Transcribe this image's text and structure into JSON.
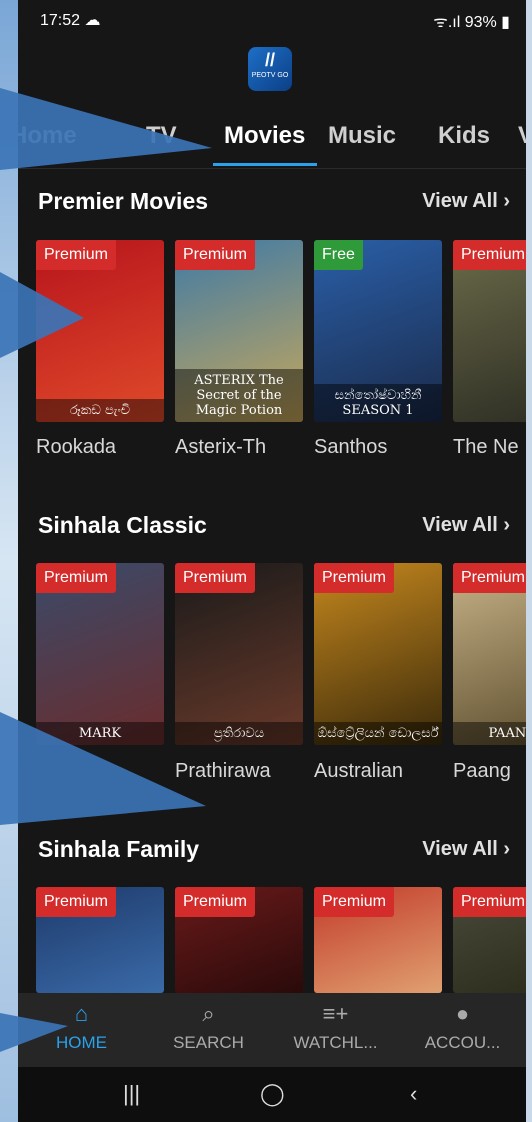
{
  "status": {
    "time": "17:52 ☁",
    "right": "ᯤ.ıl 93% ▮"
  },
  "app": {
    "logo_text": "PEOTV GO",
    "logo_mark": "//"
  },
  "tabs": [
    {
      "label": "Home"
    },
    {
      "label": "TV"
    },
    {
      "label": "Movies"
    },
    {
      "label": "Music"
    },
    {
      "label": "Kids"
    },
    {
      "label": "V"
    }
  ],
  "sections": [
    {
      "title": "Premier Movies",
      "view_all": "View All ›",
      "items": [
        {
          "badge": "Premium",
          "title": "Rookada",
          "caption": "රූකඩ පැංචි",
          "colors": [
            "#b7141c",
            "#e04a2a"
          ]
        },
        {
          "badge": "Premium",
          "title": "Asterix-Th",
          "caption": "ASTERIX The Secret of the Magic Potion",
          "colors": [
            "#3f7aa6",
            "#c8a85a"
          ]
        },
        {
          "badge": "Free",
          "title": "Santhos",
          "caption": "සන්තෝෂ්වාහිනී SEASON 1",
          "colors": [
            "#2a5fa8",
            "#1a2a4a"
          ]
        },
        {
          "badge": "Premium",
          "title": "The Ne",
          "caption": "",
          "colors": [
            "#6b6b4a",
            "#2b2b22"
          ]
        }
      ]
    },
    {
      "title": "Sinhala Classic",
      "view_all": "View All ›",
      "items": [
        {
          "badge": "Premium",
          "title": "",
          "caption": "MARK",
          "colors": [
            "#3a4a6a",
            "#6a2c2c"
          ]
        },
        {
          "badge": "Premium",
          "title": "Prathirawa",
          "caption": "ප්‍රතිරාවය",
          "colors": [
            "#1a1a1a",
            "#6a3a2a"
          ]
        },
        {
          "badge": "Premium",
          "title": "Australian",
          "caption": "ඕස්ට්‍රේලියන් ඩොලර්ස්",
          "colors": [
            "#c6881e",
            "#3a2a0a"
          ]
        },
        {
          "badge": "Premium",
          "title": "Paang",
          "caption": "PAANGS",
          "colors": [
            "#c8b48a",
            "#5a4a2a"
          ]
        }
      ]
    },
    {
      "title": "Sinhala Family",
      "view_all": "View All ›",
      "items": [
        {
          "badge": "Premium",
          "title": "",
          "caption": "",
          "colors": [
            "#1e3a6a",
            "#3a6aa8"
          ]
        },
        {
          "badge": "Premium",
          "title": "",
          "caption": "",
          "colors": [
            "#6a1a1a",
            "#2a0a0a"
          ]
        },
        {
          "badge": "Premium",
          "title": "",
          "caption": "",
          "colors": [
            "#c23a2a",
            "#e0a070"
          ]
        },
        {
          "badge": "Premium",
          "title": "",
          "caption": "",
          "colors": [
            "#4a4a3a",
            "#2a2a1a"
          ]
        }
      ]
    }
  ],
  "bottom_nav": [
    {
      "label": "HOME",
      "icon": "home-icon",
      "glyph": "⌂"
    },
    {
      "label": "SEARCH",
      "icon": "search-icon",
      "glyph": "⌕"
    },
    {
      "label": "WATCHL...",
      "icon": "watchlist-icon",
      "glyph": "≡+"
    },
    {
      "label": "ACCOU...",
      "icon": "account-icon",
      "glyph": "●"
    }
  ],
  "system_nav": {
    "recents": "|||",
    "home": "◯",
    "back": "‹"
  },
  "colors": {
    "accent": "#2aa1ea",
    "premium": "#d42b2b",
    "free": "#2f9a3a",
    "background": "#161616"
  }
}
